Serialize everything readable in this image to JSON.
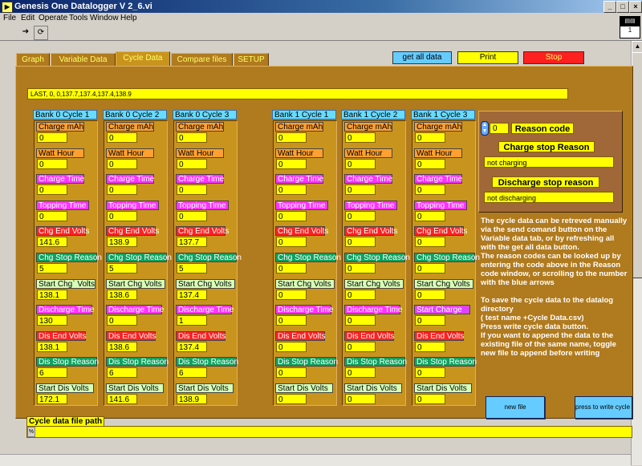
{
  "window": {
    "title": "Genesis One Datalogger V 2_6.vi",
    "icon": "labview-vi-icon"
  },
  "menu": [
    "File",
    "Edit",
    "Operate",
    "Tools",
    "Window",
    "Help"
  ],
  "vi_icon_text": "1",
  "tabs": [
    {
      "label": "Graph",
      "active": false
    },
    {
      "label": "Variable Data",
      "active": false
    },
    {
      "label": "Cycle Data",
      "active": true
    },
    {
      "label": "Compare files",
      "active": false
    },
    {
      "label": "SETUP",
      "active": false
    }
  ],
  "buttons": {
    "get_all": "get all  data",
    "print": "Print",
    "stop": "Stop",
    "new_file": "new file",
    "write": "press to write cycle data"
  },
  "status_line": "LAST,  0,  0,137.7,137.4,137.4,138.9",
  "field_labels": [
    "Charge mAh",
    "Watt Hour",
    "Charge Time",
    "Topping Time",
    "Chg End Volts",
    "Chg Stop Reason",
    "Start Chg` Volts",
    "Discharge Time",
    "Dis End Volts",
    "Dis Stop Reason",
    "Start Dis Volts"
  ],
  "columns": [
    {
      "title": "Bank 0 Cycle 1",
      "labels": [
        "Charge mAh",
        "Watt Hour",
        "Charge Time",
        "Topping Time",
        "Chg End Volts",
        "Chg Stop Reason",
        "Start Chg` Volts",
        "Discharge Time",
        "Dis End Volts",
        "Dis Stop Reason",
        "Start Dis Volts"
      ],
      "values": [
        "0",
        "0",
        "0",
        "0",
        "141.6",
        "5",
        "138.1",
        "130",
        "138.1",
        "6",
        "172.1"
      ]
    },
    {
      "title": "Bank 0 Cycle 2",
      "labels": [
        "Charge mAh",
        "Watt Hour",
        "Charge Time",
        "Topping Time",
        "Chg End Volts",
        "Chg Stop Reason",
        "Start Chg Volts",
        "Discharge Time",
        "Dis End Volts",
        "Dis Stop Reason",
        "Start Dis Volts"
      ],
      "values": [
        "0",
        "0",
        "0",
        "0",
        "138.9",
        "5",
        "138.6",
        "0",
        "138.6",
        "6",
        "141.6"
      ]
    },
    {
      "title": "Bank 0 Cycle 3",
      "labels": [
        "Charge mAh",
        "Watt Hour",
        "Charge Time",
        "Topping Time",
        "Chg End Volts",
        "Chg Stop Reason",
        "Start Chg Volts",
        "Discharge Time",
        "Dis End Volts",
        "Dis Stop Reason",
        "Start Dis Volts"
      ],
      "values": [
        "0",
        "0",
        "0",
        "0",
        "137.7",
        "5",
        "137.4",
        "1",
        "137.4",
        "6",
        "138.9"
      ]
    },
    {
      "title": "Bank 1 Cycle 1",
      "labels": [
        "Charge mAh",
        "Watt Hour",
        "Charge Time",
        "Topping Time",
        "Chg End Volts",
        "Chg Stop Reason",
        "Start Chg Volts",
        "Discharge Time",
        "Dis End Volts",
        "Dis Stop Reason",
        "Start Dis Volts"
      ],
      "values": [
        "0",
        "0",
        "0",
        "0",
        "0",
        "0",
        "0",
        "0",
        "0",
        "0",
        "0"
      ]
    },
    {
      "title": "Bank 1 Cycle 2",
      "labels": [
        "Charge mAh",
        "Watt Hour",
        "Charge Time",
        "Topping Time",
        "Chg End Volts",
        "Chg Stop Reason",
        "Start Chg Volts",
        "Discharge Time",
        "Dis End Volts",
        "Dis Stop Reason",
        "Start Dis Volts"
      ],
      "values": [
        "0",
        "0",
        "0",
        "0",
        "0",
        "0",
        "0",
        "0",
        "0",
        "0",
        "0"
      ]
    },
    {
      "title": "Bank 1 Cycle 3",
      "labels": [
        "Charge mAh",
        "Watt Hour",
        "Charge Time",
        "Topping Time",
        "Chg End Volts",
        "Chg Stop Reason",
        "Start Chg Volts",
        "Start Charge",
        "Dis End Volts",
        "Dis Stop Reason",
        "Start Dis Volts"
      ],
      "values": [
        "0",
        "0",
        "0",
        "0",
        "0",
        "0",
        "0",
        "0",
        "0",
        "0",
        "0"
      ]
    }
  ],
  "reason": {
    "code_value": "0",
    "code_label": "Reason code",
    "charge_title": "Charge stop Reason",
    "charge_value": "not charging",
    "discharge_title": "Discharge stop reason",
    "discharge_value": "not discharging"
  },
  "info_paragraphs": [
    "The cycle data can be retreved manually via the send comand button on the Variable data tab, or by refreshing all with the get all data button.",
    "The reason codes can be looked up by entering the code above in the  Reason code window, or scrolling to the number with the blue arrows",
    "To save the cycle data to the datalog directory",
    " ( test name +Cycle Data.csv)",
    "Press write cycle data button.",
    " If you want to append the data to the existing file of the same name, toggle new file to append before writing"
  ],
  "path": {
    "label": "Cycle data file path",
    "value": ""
  },
  "colors": {
    "panel_bg": "#b07a1e",
    "field_yellow": "#ffff00",
    "stop_red": "#ff2020",
    "col_head_cyan": "#66ddff"
  }
}
